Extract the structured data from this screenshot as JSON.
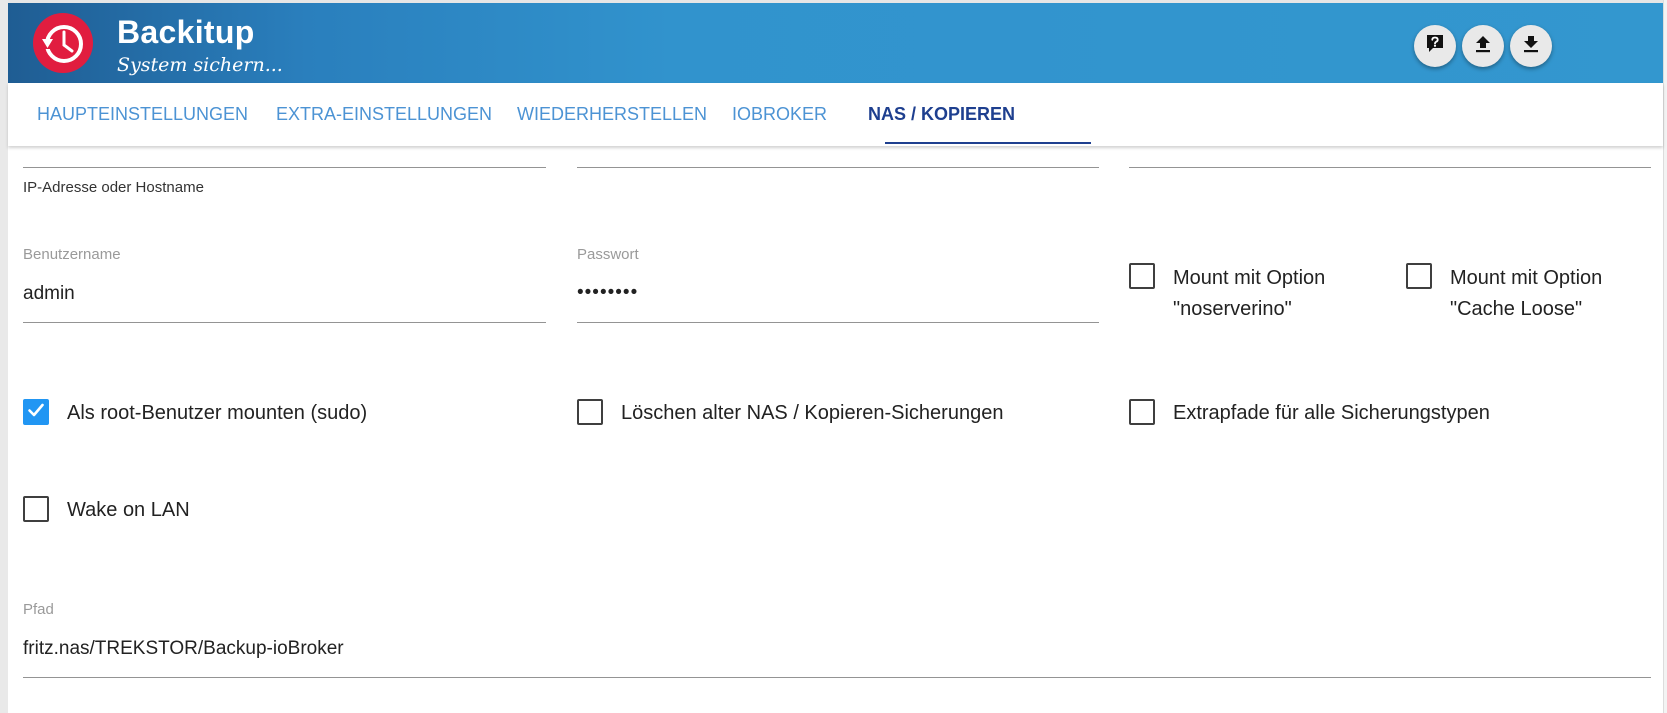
{
  "header": {
    "title": "Backitup",
    "subtitle": "System sichern...",
    "logo_icon": "clock-history-icon",
    "buttons": [
      {
        "name": "help-button",
        "icon": "help-icon"
      },
      {
        "name": "upload-button",
        "icon": "upload-icon"
      },
      {
        "name": "download-button",
        "icon": "download-icon"
      }
    ],
    "colors": {
      "bar": "#3397cf",
      "logo": "#e11d3f"
    }
  },
  "tabs": [
    {
      "label": "HAUPTEINSTELLUNGEN",
      "active": false
    },
    {
      "label": "EXTRA-EINSTELLUNGEN",
      "active": false
    },
    {
      "label": "WIEDERHERSTELLEN",
      "active": false
    },
    {
      "label": "IOBROKER",
      "active": false
    },
    {
      "label": "NAS / KOPIEREN",
      "active": true
    }
  ],
  "form": {
    "host": {
      "helper": "IP-Adresse oder Hostname"
    },
    "username": {
      "label": "Benutzername",
      "value": "admin"
    },
    "password": {
      "label": "Passwort",
      "value": "••••••••"
    },
    "path": {
      "label": "Pfad",
      "value": "fritz.nas/TREKSTOR/Backup-ioBroker"
    }
  },
  "checkboxes": {
    "noserverino": {
      "line1": "Mount mit Option",
      "line2": "\"noserverino\"",
      "checked": false
    },
    "cache_loose": {
      "line1": "Mount mit Option",
      "line2": "\"Cache Loose\"",
      "checked": false
    },
    "sudo": {
      "label": "Als root-Benutzer mounten (sudo)",
      "checked": true
    },
    "delete_old": {
      "label": "Löschen alter NAS / Kopieren-Sicherungen",
      "checked": false
    },
    "extra_paths": {
      "label": "Extrapfade für alle Sicherungstypen",
      "checked": false
    },
    "wol": {
      "label": "Wake on LAN",
      "checked": false
    }
  },
  "accent_color": "#2196f3",
  "tab_active_color": "#1e3f8f"
}
